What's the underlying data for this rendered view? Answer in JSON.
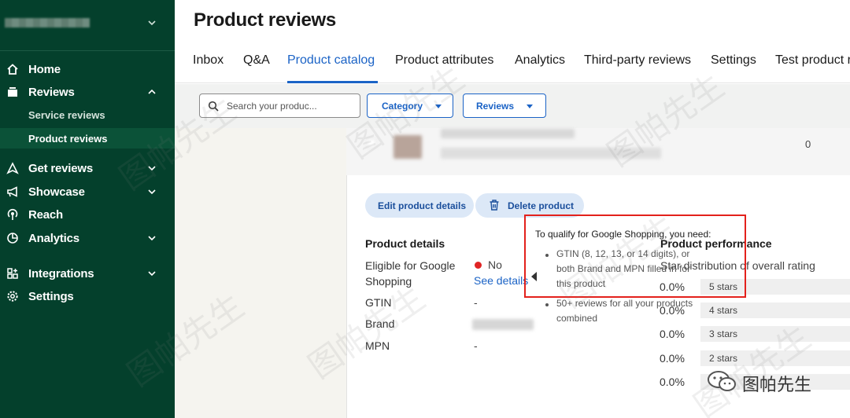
{
  "sidebar": {
    "account_name": "",
    "items": [
      {
        "label": "Home",
        "icon": "home-icon"
      },
      {
        "label": "Reviews",
        "icon": "inbox-icon",
        "expanded": true,
        "children": [
          {
            "label": "Service reviews"
          },
          {
            "label": "Product reviews",
            "active": true
          }
        ]
      },
      {
        "label": "Get reviews",
        "icon": "send-icon"
      },
      {
        "label": "Showcase",
        "icon": "megaphone-icon"
      },
      {
        "label": "Reach",
        "icon": "broadcast-icon"
      },
      {
        "label": "Analytics",
        "icon": "pie-chart-icon"
      },
      {
        "label": "Integrations",
        "icon": "grid-icon"
      },
      {
        "label": "Settings",
        "icon": "gear-icon"
      }
    ]
  },
  "header": {
    "title": "Product reviews",
    "tabs": [
      "Inbox",
      "Q&A",
      "Product catalog",
      "Product attributes",
      "Analytics",
      "Third-party reviews",
      "Settings",
      "Test product r"
    ],
    "active_tab": "Product catalog"
  },
  "filters": {
    "search_placeholder": "Search your produc...",
    "category_label": "Category",
    "reviews_label": "Reviews"
  },
  "product_row": {
    "review_count": "0"
  },
  "actions": {
    "edit_label": "Edit product details",
    "delete_label": "Delete product"
  },
  "details": {
    "title": "Product details",
    "eligible_label": "Eligible for Google Shopping",
    "eligible_value": "No",
    "see_details": "See details",
    "gtin_label": "GTIN",
    "gtin_value": "-",
    "brand_label": "Brand",
    "mpn_label": "MPN",
    "mpn_value": "-"
  },
  "performance": {
    "title": "Product performance",
    "subtitle": "Star distribution of overall rating",
    "rows": [
      {
        "pct": "0.0%",
        "label": "5 stars"
      },
      {
        "pct": "0.0%",
        "label": "4 stars"
      },
      {
        "pct": "0.0%",
        "label": "3 stars"
      },
      {
        "pct": "0.0%",
        "label": "2 stars"
      },
      {
        "pct": "0.0%",
        "label": ""
      }
    ]
  },
  "tooltip": {
    "heading": "To qualify for Google Shopping, you need:",
    "items": [
      "GTIN (8, 12, 13, or 14 digits), or both Brand and MPN filled in for this product",
      "50+ reviews for all your products combined"
    ]
  },
  "watermark": {
    "text": "图帕先生"
  },
  "colors": {
    "sidebar_bg": "#04402c",
    "accent_blue": "#1b63c6",
    "status_red": "#e02424",
    "highlight_red": "#e3211c"
  }
}
